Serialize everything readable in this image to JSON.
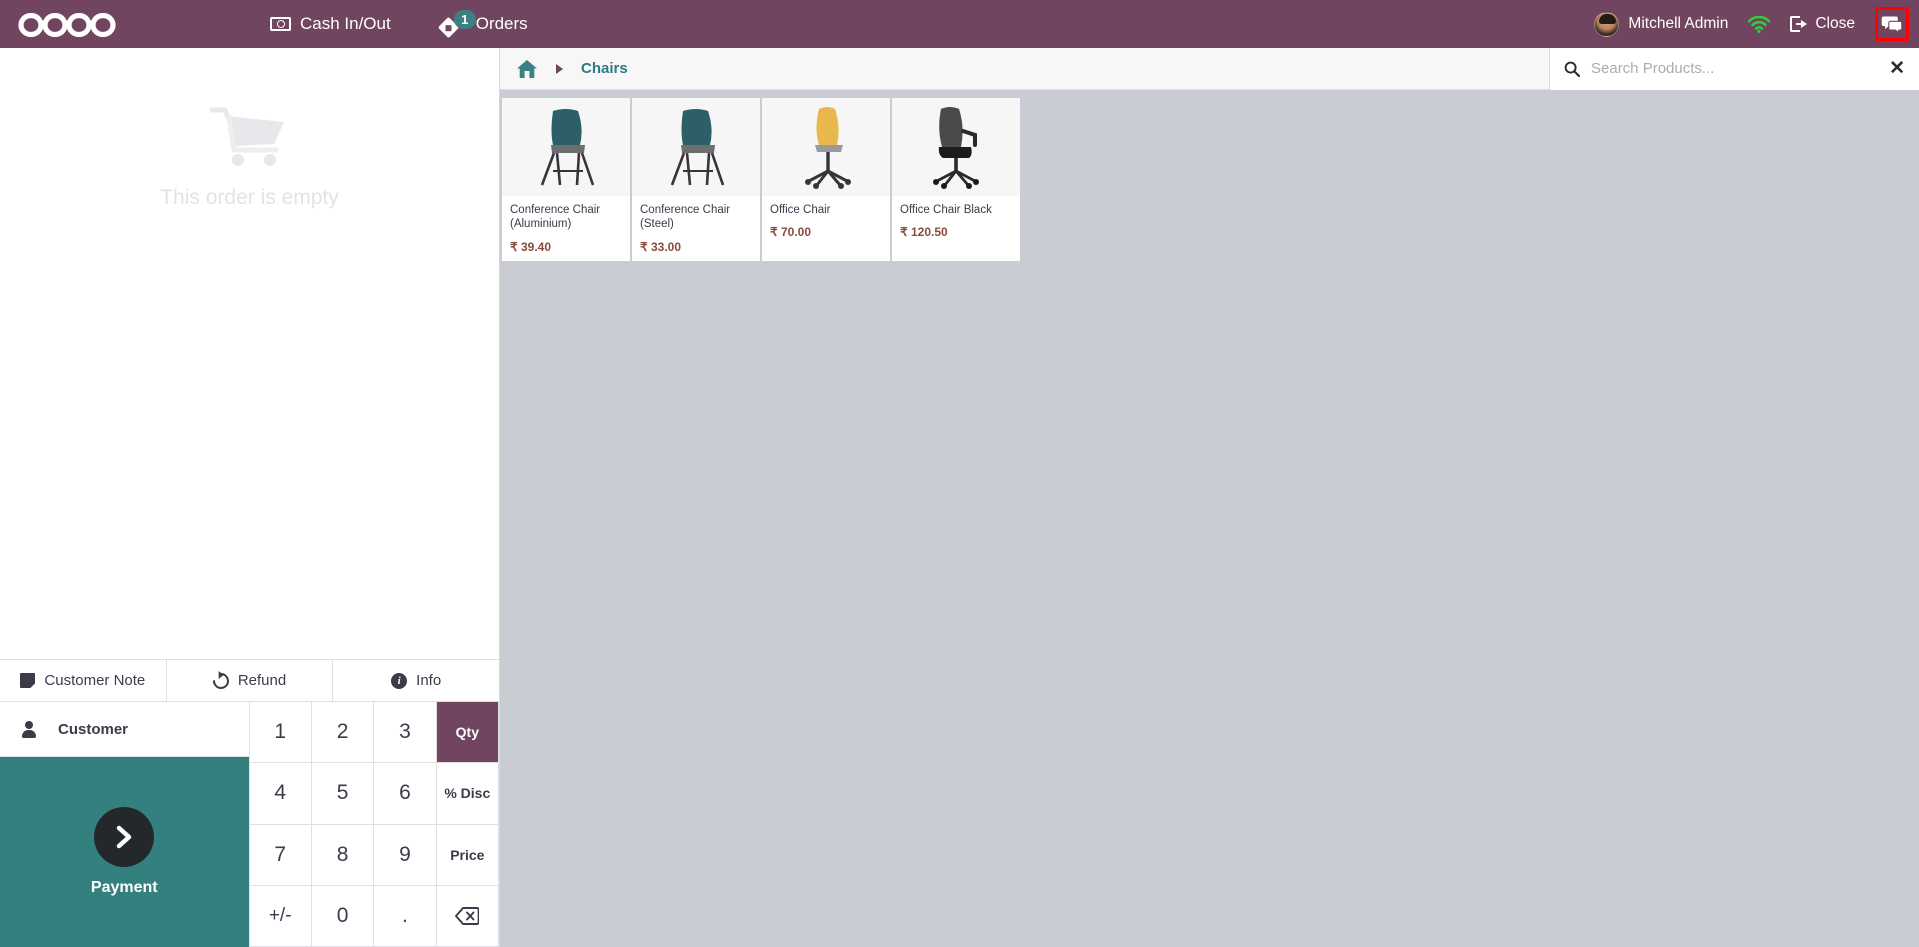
{
  "navbar": {
    "logo": "odoo",
    "cash_inout_label": "Cash In/Out",
    "cash_icon": "bill-icon",
    "orders_label": "Orders",
    "orders_icon": "ticket-icon",
    "orders_badge": "1",
    "user_name": "Mitchell Admin",
    "avatar_icon": "user-avatar",
    "wifi_icon": "wifi-icon",
    "close_label": "Close",
    "close_icon": "exit-icon",
    "chat_icon": "chat-bubbles-icon",
    "bar_color": "#71455F",
    "badge_color": "#3C8084",
    "wifi_color": "#2ECC40",
    "highlight_color": "#FF0000"
  },
  "order_panel": {
    "empty_text": "This order is empty",
    "cart_icon": "shopping-cart-icon",
    "actions": [
      {
        "label": "Customer Note",
        "icon": "note-icon"
      },
      {
        "label": "Refund",
        "icon": "refund-undo-icon"
      },
      {
        "label": "Info",
        "icon": "info-icon"
      }
    ],
    "customer_label": "Customer",
    "customer_icon": "person-icon",
    "payment_label": "Payment",
    "payment_icon": "chevron-right-icon",
    "payment_color": "#34807F",
    "numpad": [
      {
        "label": "1",
        "type": "digit"
      },
      {
        "label": "2",
        "type": "digit"
      },
      {
        "label": "3",
        "type": "digit"
      },
      {
        "label": "Qty",
        "type": "mode",
        "active": true
      },
      {
        "label": "4",
        "type": "digit"
      },
      {
        "label": "5",
        "type": "digit"
      },
      {
        "label": "6",
        "type": "digit"
      },
      {
        "label": "% Disc",
        "type": "mode",
        "active": false
      },
      {
        "label": "7",
        "type": "digit"
      },
      {
        "label": "8",
        "type": "digit"
      },
      {
        "label": "9",
        "type": "digit"
      },
      {
        "label": "Price",
        "type": "mode",
        "active": false
      },
      {
        "label": "+/-",
        "type": "digit"
      },
      {
        "label": "0",
        "type": "digit"
      },
      {
        "label": ".",
        "type": "digit"
      },
      {
        "label": "backspace",
        "type": "backspace"
      }
    ]
  },
  "product_area": {
    "home_icon": "home-icon",
    "breadcrumb_category": "Chairs",
    "search_placeholder": "Search Products...",
    "search_value": "",
    "search_icon": "search-icon",
    "search_clear_icon": "close-x-icon",
    "background_color": "#C9CCD3",
    "products": [
      {
        "name": "Conference Chair (Aluminium)",
        "price": "₹ 39.40",
        "image": "teal-conference-chair"
      },
      {
        "name": "Conference Chair (Steel)",
        "price": "₹ 33.00",
        "image": "teal-conference-chair"
      },
      {
        "name": "Office Chair",
        "price": "₹ 70.00",
        "image": "yellow-office-chair"
      },
      {
        "name": "Office Chair Black",
        "price": "₹ 120.50",
        "image": "black-office-chair"
      }
    ]
  }
}
